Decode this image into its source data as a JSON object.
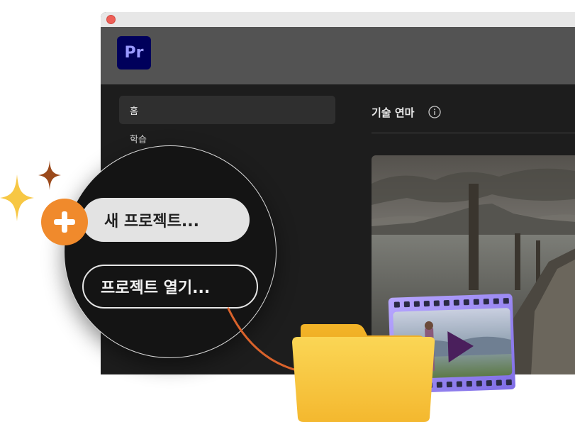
{
  "app": {
    "logo_text": "Pr"
  },
  "sidebar": {
    "items": [
      {
        "label": "홈",
        "active": true
      },
      {
        "label": "학습",
        "active": false
      }
    ]
  },
  "main": {
    "section_title": "기술 연마"
  },
  "callout": {
    "new_project_label": "새 프로젝트...",
    "open_project_label": "프로젝트 열기..."
  },
  "colors": {
    "accent_orange": "#f08a2c",
    "premiere_bg": "#00005b",
    "premiere_text": "#9999ff",
    "film_frame": "#9d8bf2",
    "folder_yellow": "#f8c235"
  },
  "icons": {
    "info": "info-icon",
    "plus": "plus-icon",
    "sparkle": "sparkle-icon",
    "folder": "folder-icon",
    "film": "film-strip-icon",
    "play": "play-icon"
  }
}
